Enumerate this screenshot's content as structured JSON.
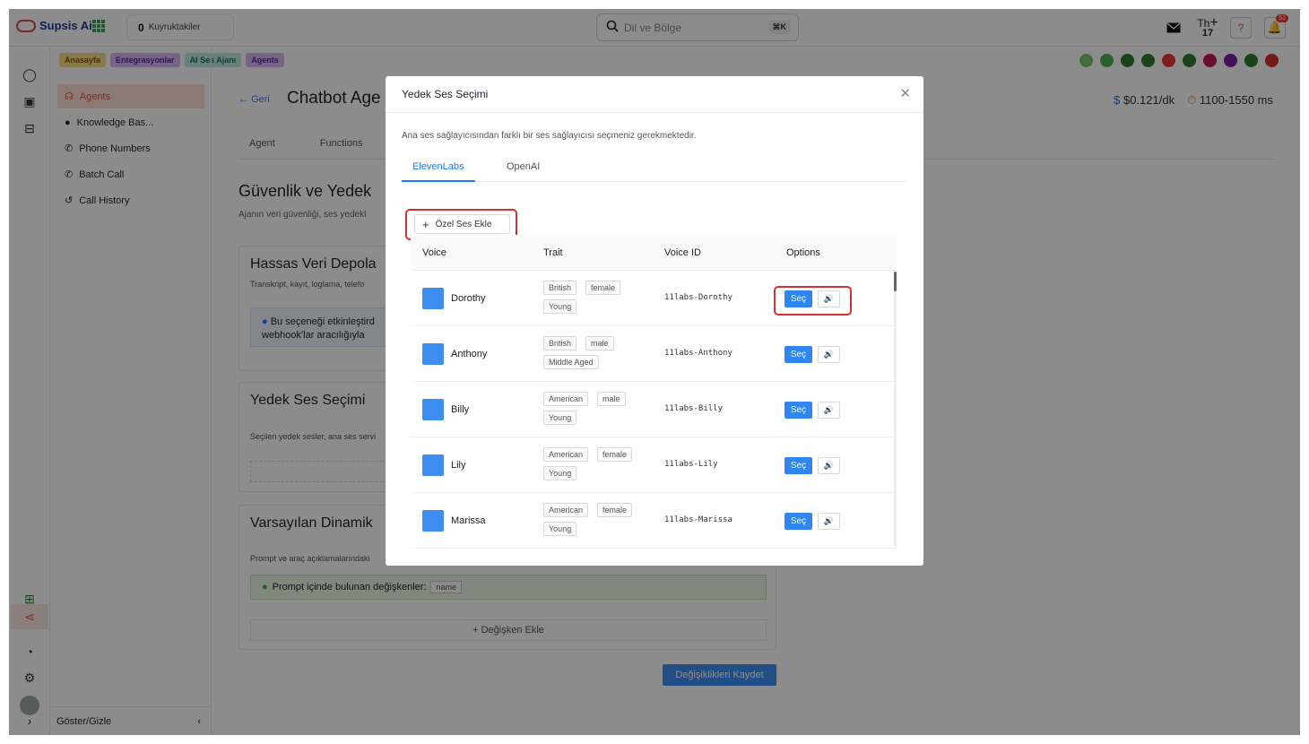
{
  "app": {
    "name": "Supsis Ai"
  },
  "topbar": {
    "queue_count": "0",
    "queue_label": "Kuyruktakiler",
    "search_placeholder": "Dil ve Bölge",
    "search_shortcut": "⌘K",
    "user_initials": "Th",
    "user_day": "17",
    "notification_count": "52"
  },
  "breadcrumbs": [
    {
      "label": "Anasayfa",
      "color": "#f5c344"
    },
    {
      "label": "Entegrasyonlar",
      "color": "#c69cf0"
    },
    {
      "label": "AI Ses Ajanı",
      "color": "#8fd6c7"
    },
    {
      "label": "Agents",
      "color": "#c69cf0"
    }
  ],
  "sidebar": {
    "items": [
      {
        "label": "Agents",
        "active": true
      },
      {
        "label": "Knowledge Bas..."
      },
      {
        "label": "Phone Numbers"
      },
      {
        "label": "Batch Call"
      },
      {
        "label": "Call History"
      }
    ],
    "footer": "Göster/Gizle"
  },
  "page": {
    "back": "Geri",
    "title": "Chatbot Age",
    "price": "$0.121/dk",
    "latency": "1100-1550 ms",
    "tabs": [
      "Agent",
      "Functions"
    ],
    "section_title": "Güvenlik ve Yedek",
    "section_sub": "Ajanın veri güvenliği, ses yedekl",
    "card1": {
      "title": "Hassas Veri Depola",
      "desc": "Transkript, kayıt, loglama, telefo",
      "info_line1": "Bu seçeneği etkinleştird",
      "info_line2": "webhook'lar aracılığıyla"
    },
    "card2": {
      "title": "Yedek Ses Seçimi",
      "desc": "Seçilen yedek sesler, ana ses servi"
    },
    "card3": {
      "title": "Varsayılan Dinamik",
      "desc": "Prompt ve araç açıklamalarındaki",
      "vars_label": "Prompt içinde bulunan değişkenler:",
      "var_tag": "name",
      "add_variable": "+ Değişken Ekle"
    },
    "save": "Değişiklikleri Kaydet"
  },
  "modal": {
    "title": "Yedek Ses Seçimi",
    "description": "Ana ses sağlayıcısından farklı bir ses sağlayıcısı seçmeniz gerekmektedir.",
    "tabs": [
      {
        "label": "ElevenLabs",
        "active": true
      },
      {
        "label": "OpenAI"
      }
    ],
    "add_custom": "Özel Ses Ekle",
    "columns": {
      "voice": "Voice",
      "trait": "Trait",
      "voice_id": "Voice ID",
      "options": "Options"
    },
    "select_label": "Seç",
    "rows": [
      {
        "name": "Dorothy",
        "traits": [
          "British",
          "female",
          "Young"
        ],
        "id": "11labs-Dorothy"
      },
      {
        "name": "Anthony",
        "traits": [
          "British",
          "male",
          "Middle Aged"
        ],
        "id": "11labs-Anthony"
      },
      {
        "name": "Billy",
        "traits": [
          "American",
          "male",
          "Young"
        ],
        "id": "11labs-Billy"
      },
      {
        "name": "Lily",
        "traits": [
          "American",
          "female",
          "Young"
        ],
        "id": "11labs-Lily"
      },
      {
        "name": "Marissa",
        "traits": [
          "American",
          "female",
          "Young"
        ],
        "id": "11labs-Marissa"
      }
    ]
  },
  "colors": {
    "accent": "#1677ff",
    "select_button": "#2f86f0",
    "highlight": "#d73030",
    "swatch": "#3d8ef0"
  }
}
